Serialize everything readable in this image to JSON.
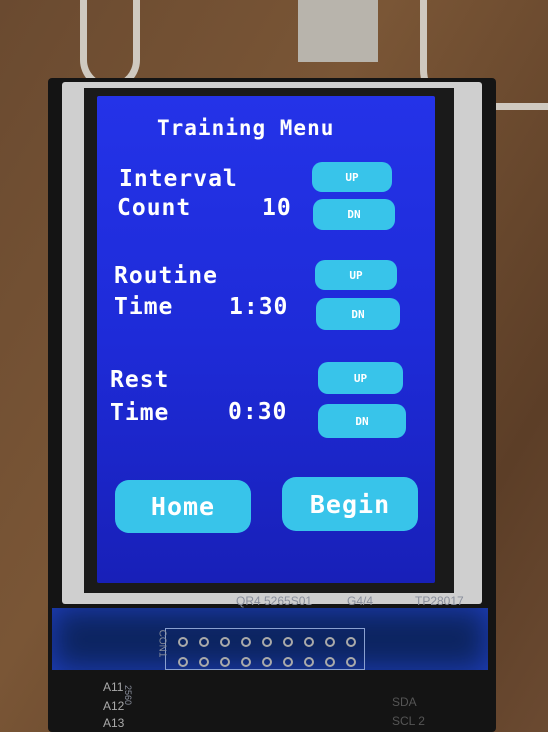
{
  "screen": {
    "title": "Training Menu",
    "interval": {
      "label1": "Interval",
      "label2": "Count",
      "value": "10",
      "up": "UP",
      "dn": "DN"
    },
    "routine": {
      "label1": "Routine",
      "label2": "Time",
      "value": "1:30",
      "up": "UP",
      "dn": "DN"
    },
    "rest": {
      "label1": "Rest",
      "label2": "Time",
      "value": "0:30",
      "up": "UP",
      "dn": "DN"
    },
    "home": "Home",
    "begin": "Begin",
    "colors": {
      "background": "#2433e8",
      "button": "#38c4ea",
      "text": "#ffffff"
    }
  },
  "board": {
    "silk1": "QR4 5265S01",
    "silk2": "G4/4",
    "silk3": "TP28017",
    "connector": "CON1",
    "pins": [
      "A11",
      "A12",
      "A13"
    ],
    "chip": "2560",
    "sda": "SDA",
    "scl": "SCL 2"
  }
}
